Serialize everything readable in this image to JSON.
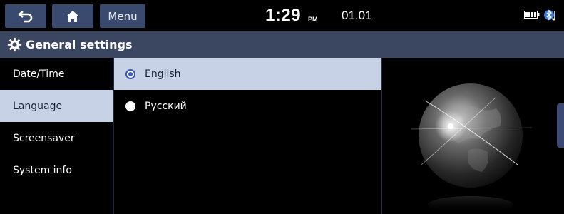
{
  "topbar": {
    "back_icon": "back-arrow-icon",
    "home_icon": "home-icon",
    "menu_label": "Menu",
    "clock": "1:29",
    "ampm": "PM",
    "date": "01.01",
    "battery_icon": "battery-icon",
    "bluetooth_icon": "bluetooth-icon"
  },
  "header": {
    "icon": "gear-icon",
    "title": "General settings"
  },
  "sidebar": {
    "items": [
      {
        "label": "Date/Time",
        "active": false
      },
      {
        "label": "Language",
        "active": true
      },
      {
        "label": "Screensaver",
        "active": false
      },
      {
        "label": "System info",
        "active": false
      }
    ]
  },
  "languages": {
    "options": [
      {
        "label": "English",
        "selected": true
      },
      {
        "label": "Русский",
        "selected": false
      }
    ]
  },
  "colors": {
    "header_bg": "#3b4660",
    "selection_bg": "#c8d2e6",
    "button_bg": "#3a4a6e",
    "radio_accent": "#3e57b0"
  }
}
